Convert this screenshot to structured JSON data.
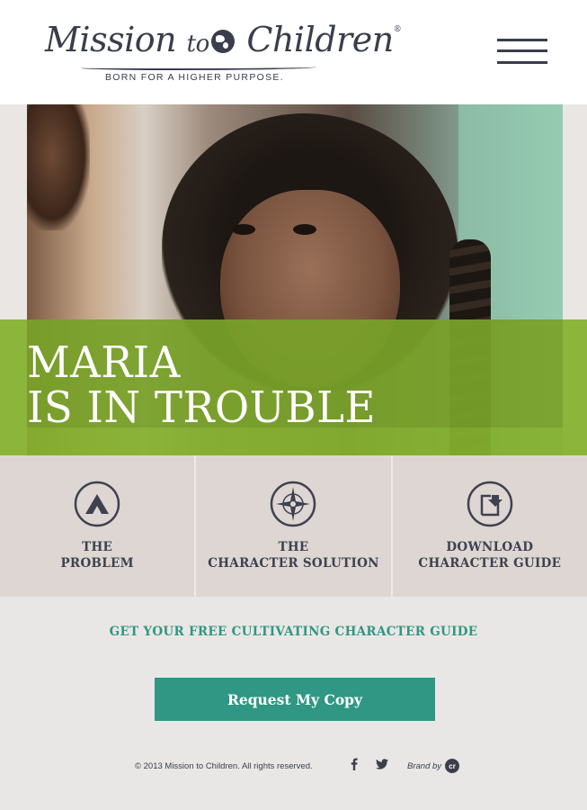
{
  "header": {
    "logo_text_part1": "Mission",
    "logo_text_part2": "to",
    "logo_text_part3": "Children",
    "logo_registered": "®",
    "tagline": "BORN FOR A HIGHER PURPOSE.",
    "menu_icon": "hamburger-menu-icon"
  },
  "hero": {
    "title_line1": "MARIA",
    "title_line2": "IS IN TROUBLE",
    "overlay_color": "#84b02e"
  },
  "features": [
    {
      "line1": "THE",
      "line2": "PROBLEM",
      "icon": "mountain-icon"
    },
    {
      "line1": "THE",
      "line2": "CHARACTER SOLUTION",
      "icon": "compass-icon"
    },
    {
      "line1": "DOWNLOAD",
      "line2": "CHARACTER GUIDE",
      "icon": "download-icon"
    }
  ],
  "cta": {
    "heading": "GET YOUR FREE CULTIVATING CHARACTER GUIDE",
    "button_label": "Request My Copy",
    "accent_color": "#2f9783"
  },
  "footer": {
    "copyright": "© 2013 Mission to Children. All rights reserved.",
    "brand_by": "Brand by",
    "brand_logo_text": "cr",
    "social": [
      "facebook-icon",
      "twitter-icon"
    ]
  }
}
